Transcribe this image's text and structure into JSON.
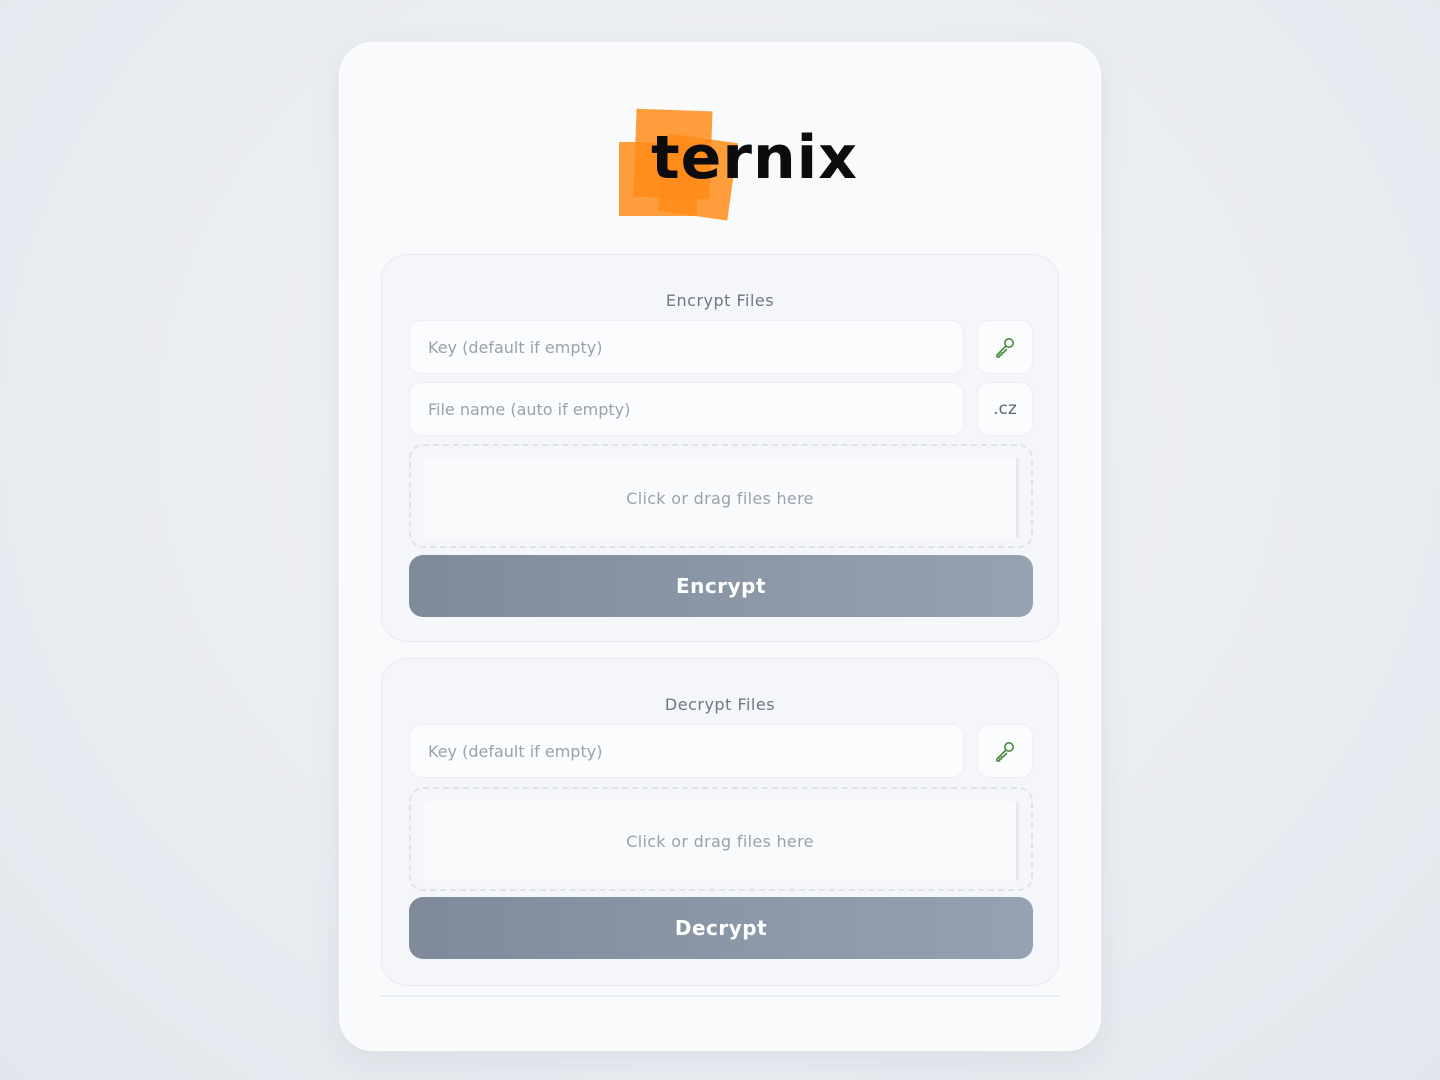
{
  "brand": {
    "name": "ternix",
    "accent": "#ff8c1a"
  },
  "encrypt": {
    "title": "Encrypt Files",
    "key_placeholder": "Key (default if empty)",
    "key_button_icon": "key-icon",
    "filename_placeholder": "File name (auto if empty)",
    "extension": ".cz",
    "dropzone_text": "Click or drag files here",
    "button_label": "Encrypt"
  },
  "decrypt": {
    "title": "Decrypt Files",
    "key_placeholder": "Key (default if empty)",
    "key_button_icon": "key-icon",
    "dropzone_text": "Click or drag files here",
    "button_label": "Decrypt"
  },
  "colors": {
    "key_icon": "#4a8a3c",
    "button_gradient_start": "#7f8a9b",
    "button_gradient_end": "#96a2b2"
  }
}
